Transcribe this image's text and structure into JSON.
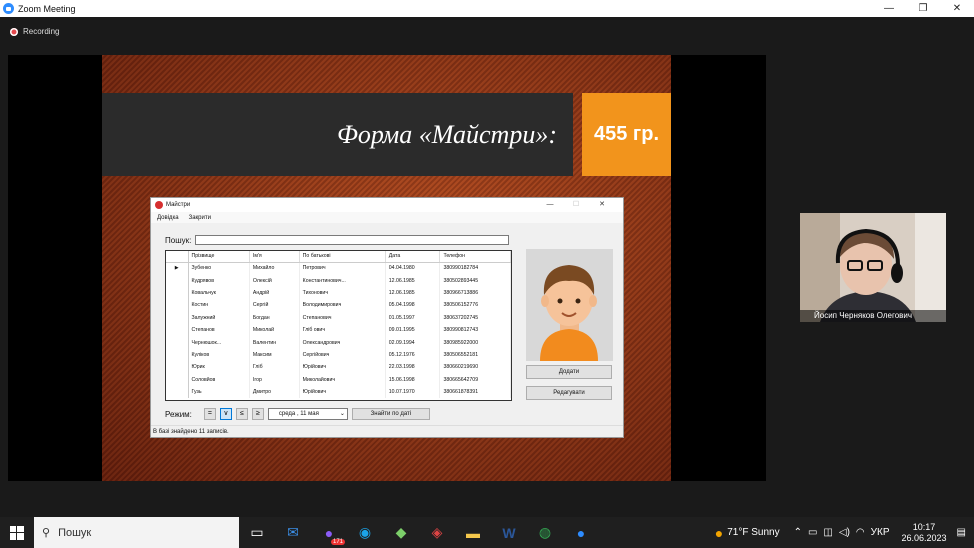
{
  "app": {
    "title": "Zoom Meeting",
    "recording": "Recording"
  },
  "slide": {
    "heading": "Форма «Майстри»:",
    "price": "455 гр."
  },
  "form": {
    "title": "Майстри",
    "menu": [
      "Довідка",
      "Закрити"
    ],
    "search_label": "Пошук:",
    "columns": [
      "Прізвище",
      "Ім'я",
      "По батькові",
      "Дата",
      "Телефон"
    ],
    "rows": [
      [
        "Зубенко",
        "Михайло",
        "Петрович",
        "04.04.1980",
        "380990182784"
      ],
      [
        "Кудрявов",
        "Олексій",
        "Константинович...",
        "12.06.1985",
        "380502893445"
      ],
      [
        "Ковальчук",
        "Андрій",
        "Тихонович",
        "12.06.1985",
        "380966713886"
      ],
      [
        "Костин",
        "Сергій",
        "Володимирович",
        "05.04.1998",
        "380506152776"
      ],
      [
        "Залужний",
        "Богдан",
        "Степанович",
        "01.05.1997",
        "380637202745"
      ],
      [
        "Степанов",
        "Миколай",
        "Гліб ович",
        "09.01.1995",
        "380990812743"
      ],
      [
        "Чернюшок...",
        "Валентин",
        "Олександрович",
        "02.09.1994",
        "380985922000"
      ],
      [
        "Куліков",
        "Максим",
        "Сергійович",
        "05.12.1976",
        "380506552181"
      ],
      [
        "Юрик",
        "Гліб",
        "Юрійович",
        "22.03.1998",
        "380660219690"
      ],
      [
        "Соловйов",
        "Ігор",
        "Миколайович",
        "15.06.1998",
        "380665642709"
      ],
      [
        "Гузь",
        "Дмитро",
        "Юрійович",
        "10.07.1970",
        "380661878391"
      ]
    ],
    "add_button": "Додати",
    "edit_button": "Редагувати",
    "mode_label": "Режим:",
    "mode_buttons": [
      "=",
      "∨",
      "≤",
      "≥"
    ],
    "date_value": "среда   , 11   мая",
    "find_button": "Знайти по даті",
    "status": "В базі знайдено 11 записів."
  },
  "participant": {
    "name": "Йосип Черняков Олегович"
  },
  "taskbar": {
    "search": "Пошук",
    "weather": "71°F  Sunny",
    "lang": "УКР",
    "time": "10:17",
    "date": "26.06.2023",
    "badge": "171"
  }
}
